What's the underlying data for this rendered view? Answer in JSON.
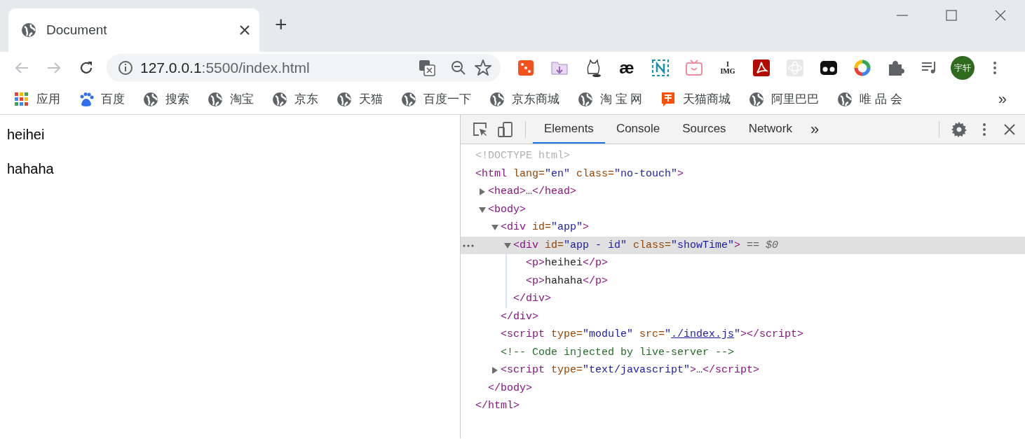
{
  "tab": {
    "title": "Document",
    "selected": true
  },
  "new_tab": "+",
  "address": {
    "host": "127.0.0.1",
    "path": ":5500/index.html"
  },
  "extensions": [
    {
      "kind": "dice"
    },
    {
      "kind": "folder"
    },
    {
      "kind": "cat"
    },
    {
      "kind": "glyph",
      "text": "æ"
    },
    {
      "kind": "nframe"
    },
    {
      "kind": "tv"
    },
    {
      "kind": "imglove",
      "text": "I",
      "text2": "IMG"
    },
    {
      "kind": "pdf"
    },
    {
      "kind": "atom"
    },
    {
      "kind": "dots"
    },
    {
      "kind": "ring"
    },
    {
      "kind": "puzzle"
    },
    {
      "kind": "playlist"
    }
  ],
  "avatar": "宇轩",
  "bookmarks": [
    {
      "kind": "apps",
      "label": "应用"
    },
    {
      "kind": "baidu",
      "label": "百度"
    },
    {
      "kind": "globe",
      "label": "搜索"
    },
    {
      "kind": "globe",
      "label": "淘宝"
    },
    {
      "kind": "globe",
      "label": "京东"
    },
    {
      "kind": "globe",
      "label": "天猫"
    },
    {
      "kind": "globe",
      "label": "百度一下"
    },
    {
      "kind": "globe",
      "label": "京东商城"
    },
    {
      "kind": "globe",
      "label": "淘 宝 网"
    },
    {
      "kind": "taobao",
      "label": "天猫商城"
    },
    {
      "kind": "globe",
      "label": "阿里巴巴"
    },
    {
      "kind": "globe",
      "label": "唯 品 会"
    }
  ],
  "bookmarks_more": "»",
  "page": {
    "paragraphs": [
      "heihei",
      "hahaha"
    ]
  },
  "devtools": {
    "tabs": [
      {
        "label": "Elements",
        "selected": true
      },
      {
        "label": "Console",
        "selected": false
      },
      {
        "label": "Sources",
        "selected": false
      },
      {
        "label": "Network",
        "selected": false
      }
    ],
    "more_tabs": "»",
    "tree": [
      {
        "selected": false,
        "parts": [
          {
            "kind": "doctype",
            "text": "<!DOCTYPE html>"
          }
        ]
      },
      {
        "selected": false,
        "parts": [
          {
            "kind": "tag",
            "text": "<html"
          },
          {
            "kind": "attr",
            "text": " lang="
          },
          {
            "kind": "value",
            "text": "\"en\""
          },
          {
            "kind": "attr",
            "text": " class="
          },
          {
            "kind": "value",
            "text": "\"no-touch\""
          },
          {
            "kind": "tag",
            "text": ">"
          }
        ],
        "children": [
          {
            "selected": false,
            "expanded": false,
            "parts": [
              {
                "kind": "tag",
                "text": "<head>"
              },
              {
                "kind": "text",
                "text": "…"
              },
              {
                "kind": "tag",
                "text": "</head>"
              }
            ]
          },
          {
            "selected": false,
            "expanded": true,
            "parts": [
              {
                "kind": "tag",
                "text": "<body>"
              }
            ],
            "children": [
              {
                "selected": false,
                "expanded": true,
                "parts": [
                  {
                    "kind": "tag",
                    "text": "<div"
                  },
                  {
                    "kind": "attr",
                    "text": " id="
                  },
                  {
                    "kind": "value",
                    "text": "\"app\""
                  },
                  {
                    "kind": "tag",
                    "text": ">"
                  }
                ],
                "children": [
                  {
                    "selected": true,
                    "expanded": true,
                    "parts": [
                      {
                        "kind": "tag",
                        "text": "<div"
                      },
                      {
                        "kind": "attr",
                        "text": " id="
                      },
                      {
                        "kind": "value",
                        "text": "\"app - id\""
                      },
                      {
                        "kind": "attr",
                        "text": " class="
                      },
                      {
                        "kind": "value",
                        "text": "\"showTime\""
                      },
                      {
                        "kind": "tag",
                        "text": ">"
                      },
                      {
                        "kind": "hint",
                        "text": " == $0"
                      }
                    ],
                    "children": [
                      {
                        "selected": false,
                        "parts": [
                          {
                            "kind": "tag",
                            "text": "<p>"
                          },
                          {
                            "kind": "text",
                            "text": "heihei"
                          },
                          {
                            "kind": "tag",
                            "text": "</p>"
                          }
                        ]
                      },
                      {
                        "selected": false,
                        "parts": [
                          {
                            "kind": "tag",
                            "text": "<p>"
                          },
                          {
                            "kind": "text",
                            "text": "hahaha"
                          },
                          {
                            "kind": "tag",
                            "text": "</p>"
                          }
                        ]
                      }
                    ],
                    "closing": [
                      {
                        "kind": "tag",
                        "text": "</div>"
                      }
                    ]
                  }
                ],
                "closing": [
                  {
                    "kind": "tag",
                    "text": "</div>"
                  }
                ]
              },
              {
                "selected": false,
                "parts": [
                  {
                    "kind": "tag",
                    "text": "<script"
                  },
                  {
                    "kind": "attr",
                    "text": " type="
                  },
                  {
                    "kind": "value",
                    "text": "\"module\""
                  },
                  {
                    "kind": "attr",
                    "text": " src="
                  },
                  {
                    "kind": "value",
                    "text": "\""
                  },
                  {
                    "kind": "link",
                    "text": "./index.js"
                  },
                  {
                    "kind": "value",
                    "text": "\""
                  },
                  {
                    "kind": "tag",
                    "text": "></script>"
                  }
                ]
              },
              {
                "selected": false,
                "parts": [
                  {
                    "kind": "comment",
                    "text": "<!-- Code injected by live-server -->"
                  }
                ]
              },
              {
                "selected": false,
                "expanded": false,
                "parts": [
                  {
                    "kind": "tag",
                    "text": "<script"
                  },
                  {
                    "kind": "attr",
                    "text": " type="
                  },
                  {
                    "kind": "value",
                    "text": "\"text/javascript\""
                  },
                  {
                    "kind": "tag",
                    "text": ">"
                  },
                  {
                    "kind": "text",
                    "text": "…"
                  },
                  {
                    "kind": "tag",
                    "text": "</script>"
                  }
                ]
              }
            ],
            "closing": [
              {
                "kind": "tag",
                "text": "</body>"
              }
            ]
          }
        ],
        "closing": [
          {
            "kind": "tag",
            "text": "</html>"
          }
        ]
      }
    ]
  }
}
